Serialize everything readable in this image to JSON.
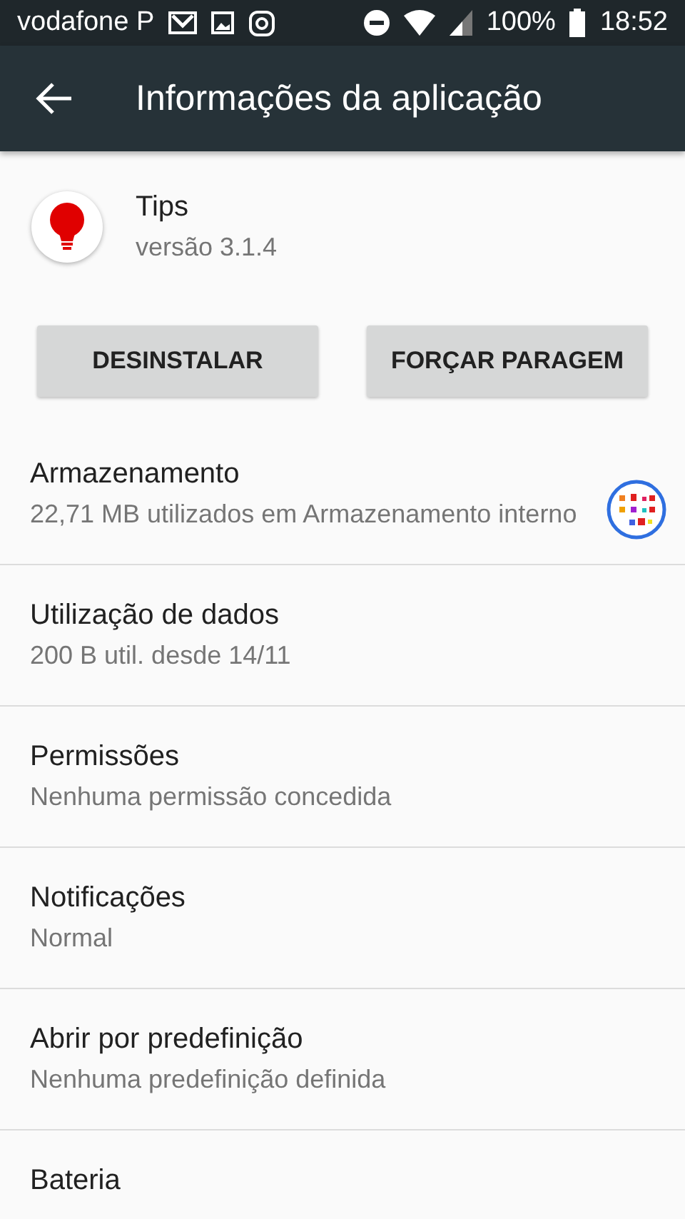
{
  "status_bar": {
    "carrier": "vodafone P",
    "battery": "100%",
    "time": "18:52"
  },
  "toolbar": {
    "title": "Informações da aplicação"
  },
  "app": {
    "name": "Tips",
    "version": "versão 3.1.4"
  },
  "buttons": [
    "DESINSTALAR",
    "FORÇAR PARAGEM"
  ],
  "items": [
    {
      "title": "Armazenamento",
      "subtitle": "22,71 MB utilizados em Armazenamento interno"
    },
    {
      "title": "Utilização de dados",
      "subtitle": "200 B util. desde 14/11"
    },
    {
      "title": "Permissões",
      "subtitle": "Nenhuma permissão concedida"
    },
    {
      "title": "Notificações",
      "subtitle": "Normal"
    },
    {
      "title": "Abrir por predefinição",
      "subtitle": "Nenhuma predefinição definida"
    },
    {
      "title": "Bateria"
    }
  ]
}
